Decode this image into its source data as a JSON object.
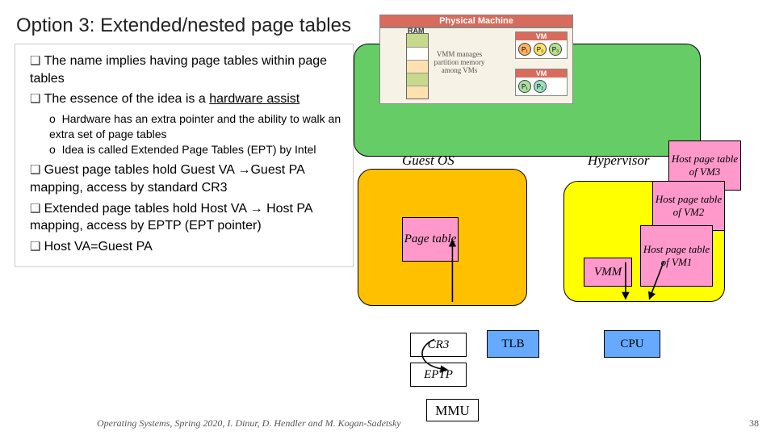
{
  "title": "Option 3: Extended/nested page tables",
  "bullets": {
    "b1": "The name implies having page tables within page tables",
    "b2a": "The essence of the idea is a ",
    "b2u": "hardware assist",
    "s1": "Hardware has an extra pointer and the ability to walk an extra set of page tables",
    "s2": "Idea is called Extended Page Tables (EPT) by Intel",
    "b3": "Guest page tables hold Guest VA →Guest PA mapping, access by standard CR3",
    "b4": "Extended page tables hold Host VA → Host PA mapping, access by EPTP (EPT pointer)",
    "b5": "Host VA=Guest PA"
  },
  "diagram": {
    "guest_os": "Guest OS",
    "hypervisor": "Hypervisor",
    "page_table": "Page table",
    "vmm": "VMM",
    "host_pt1": "Host page table of VM1",
    "host_pt2": "Host page table of VM2",
    "host_pt3": "Host page table of VM3",
    "cr3": "CR3",
    "eptp": "EPTP",
    "tlb": "TLB",
    "cpu": "CPU",
    "mmu": "MMU"
  },
  "pm": {
    "title": "Physical Machine",
    "ram": "RAM",
    "vmm_text": "VMM manages partition memory among VMs",
    "vm": "VM"
  },
  "footer": {
    "text": "Operating Systems, Spring 2020, I. Dinur, D. Hendler and M. Kogan-Sadetsky",
    "page": "38"
  }
}
